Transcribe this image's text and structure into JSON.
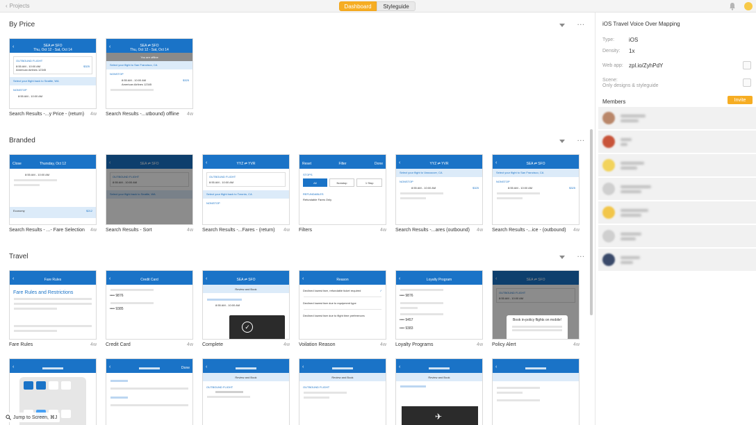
{
  "topbar": {
    "back_label": "Projects",
    "tabs": [
      {
        "label": "Dashboard",
        "active": true
      },
      {
        "label": "Styleguide",
        "active": false
      }
    ]
  },
  "sections": [
    {
      "title": "By Price",
      "cards": [
        {
          "name": "Search Results -...y Price - (return)",
          "age": "4w"
        },
        {
          "name": "Search Results -...utbound) offline",
          "age": "4w"
        }
      ]
    },
    {
      "title": "Branded",
      "cards": [
        {
          "name": "Search Results - ...- Fare Selection",
          "age": "4w"
        },
        {
          "name": "Search Results - Sort",
          "age": "4w"
        },
        {
          "name": "Search Results -...Fares - (return)",
          "age": "4w"
        },
        {
          "name": "Filters",
          "age": "4w"
        },
        {
          "name": "Search Results -...ares (outbound)",
          "age": "4w"
        },
        {
          "name": "Search Results -...ice - (outbound)",
          "age": "4w"
        }
      ]
    },
    {
      "title": "Travel",
      "cards": [
        {
          "name": "Fare Rules",
          "age": "4w"
        },
        {
          "name": "Credit Card",
          "age": "4w"
        },
        {
          "name": "Complete",
          "age": "4w"
        },
        {
          "name": "Voilation Reason",
          "age": "4w"
        },
        {
          "name": "Loyalty Programs",
          "age": "4w"
        },
        {
          "name": "Policy Alert",
          "age": "4w"
        }
      ]
    }
  ],
  "screens": {
    "s_sea_sfo": "SEA ⇄ SFO",
    "s_dates": "Thu, Oct 12 - Sat, Oct 14",
    "s_outbound": "OUTBOUND FLIGHT",
    "s_time": "8:55 AM - 10:00 AM",
    "s_airline": "American Airlines 12345",
    "s_price": "$325",
    "s_select_back": "Select your flight back to Seattle, WA",
    "s_nonstop": "NONSTOP",
    "s_offline": "You are offline",
    "s_select_sf": "Select your flight to San Francisco, CA",
    "s_close": "Close",
    "s_thursday": "Thursday, Oct 12",
    "s_economy": "Economy",
    "s_econ_price": "$212",
    "s_yyz": "YYZ ⇄ YVR",
    "s_back_toronto": "Select your flight back to Toronto, CA",
    "s_reset": "Reset",
    "s_filter": "Filter",
    "s_done": "Done",
    "s_stops": "STOPS",
    "s_all": "All",
    "s_nonstop_btn": "Nonstop",
    "s_1stop": "1 Stop",
    "s_refundables": "REFUNDABLES",
    "s_refundable_only": "Refundable Fares Only",
    "s_to_vancouver": "Select your flight to Vancouver, CA",
    "s_fare_rules": "Fare Rules",
    "s_fare_rules_h": "Fare Rules and Restrictions",
    "s_credit_card": "Credit Card",
    "s_card1": "•••• 9876",
    "s_card2": "•••• 9385",
    "s_review": "Review and Book",
    "s_reason": "Reason",
    "s_reason1": "Declined lowest fare, refundable ticket required",
    "s_reason2": "Declined lowest fare due to equipment type",
    "s_reason3": "Declined lowest fare due to flight time preferences",
    "s_loyalty": "Loyalty Program",
    "s_loy1": "•••• 9876",
    "s_loy2": "•••• 9457",
    "s_loy3": "•••• 9383",
    "s_policy": "Book in-policy flights on mobile!"
  },
  "panel": {
    "title": "iOS Travel Voice Over Mapping",
    "type_label": "Type:",
    "type_value": "iOS",
    "density_label": "Density:",
    "density_value": "1x",
    "webapp_label": "Web app:",
    "webapp_value": "zpl.io/ZyhPdY",
    "scene_label": "Scene:",
    "scene_value": "Only designs & styleguide",
    "members_label": "Members",
    "invite_label": "Invite"
  },
  "jump": {
    "label": "Jump to Screen, ⌘J"
  },
  "colors": {
    "accent": "#f6ad23",
    "ios_blue": "#1a73c7"
  }
}
